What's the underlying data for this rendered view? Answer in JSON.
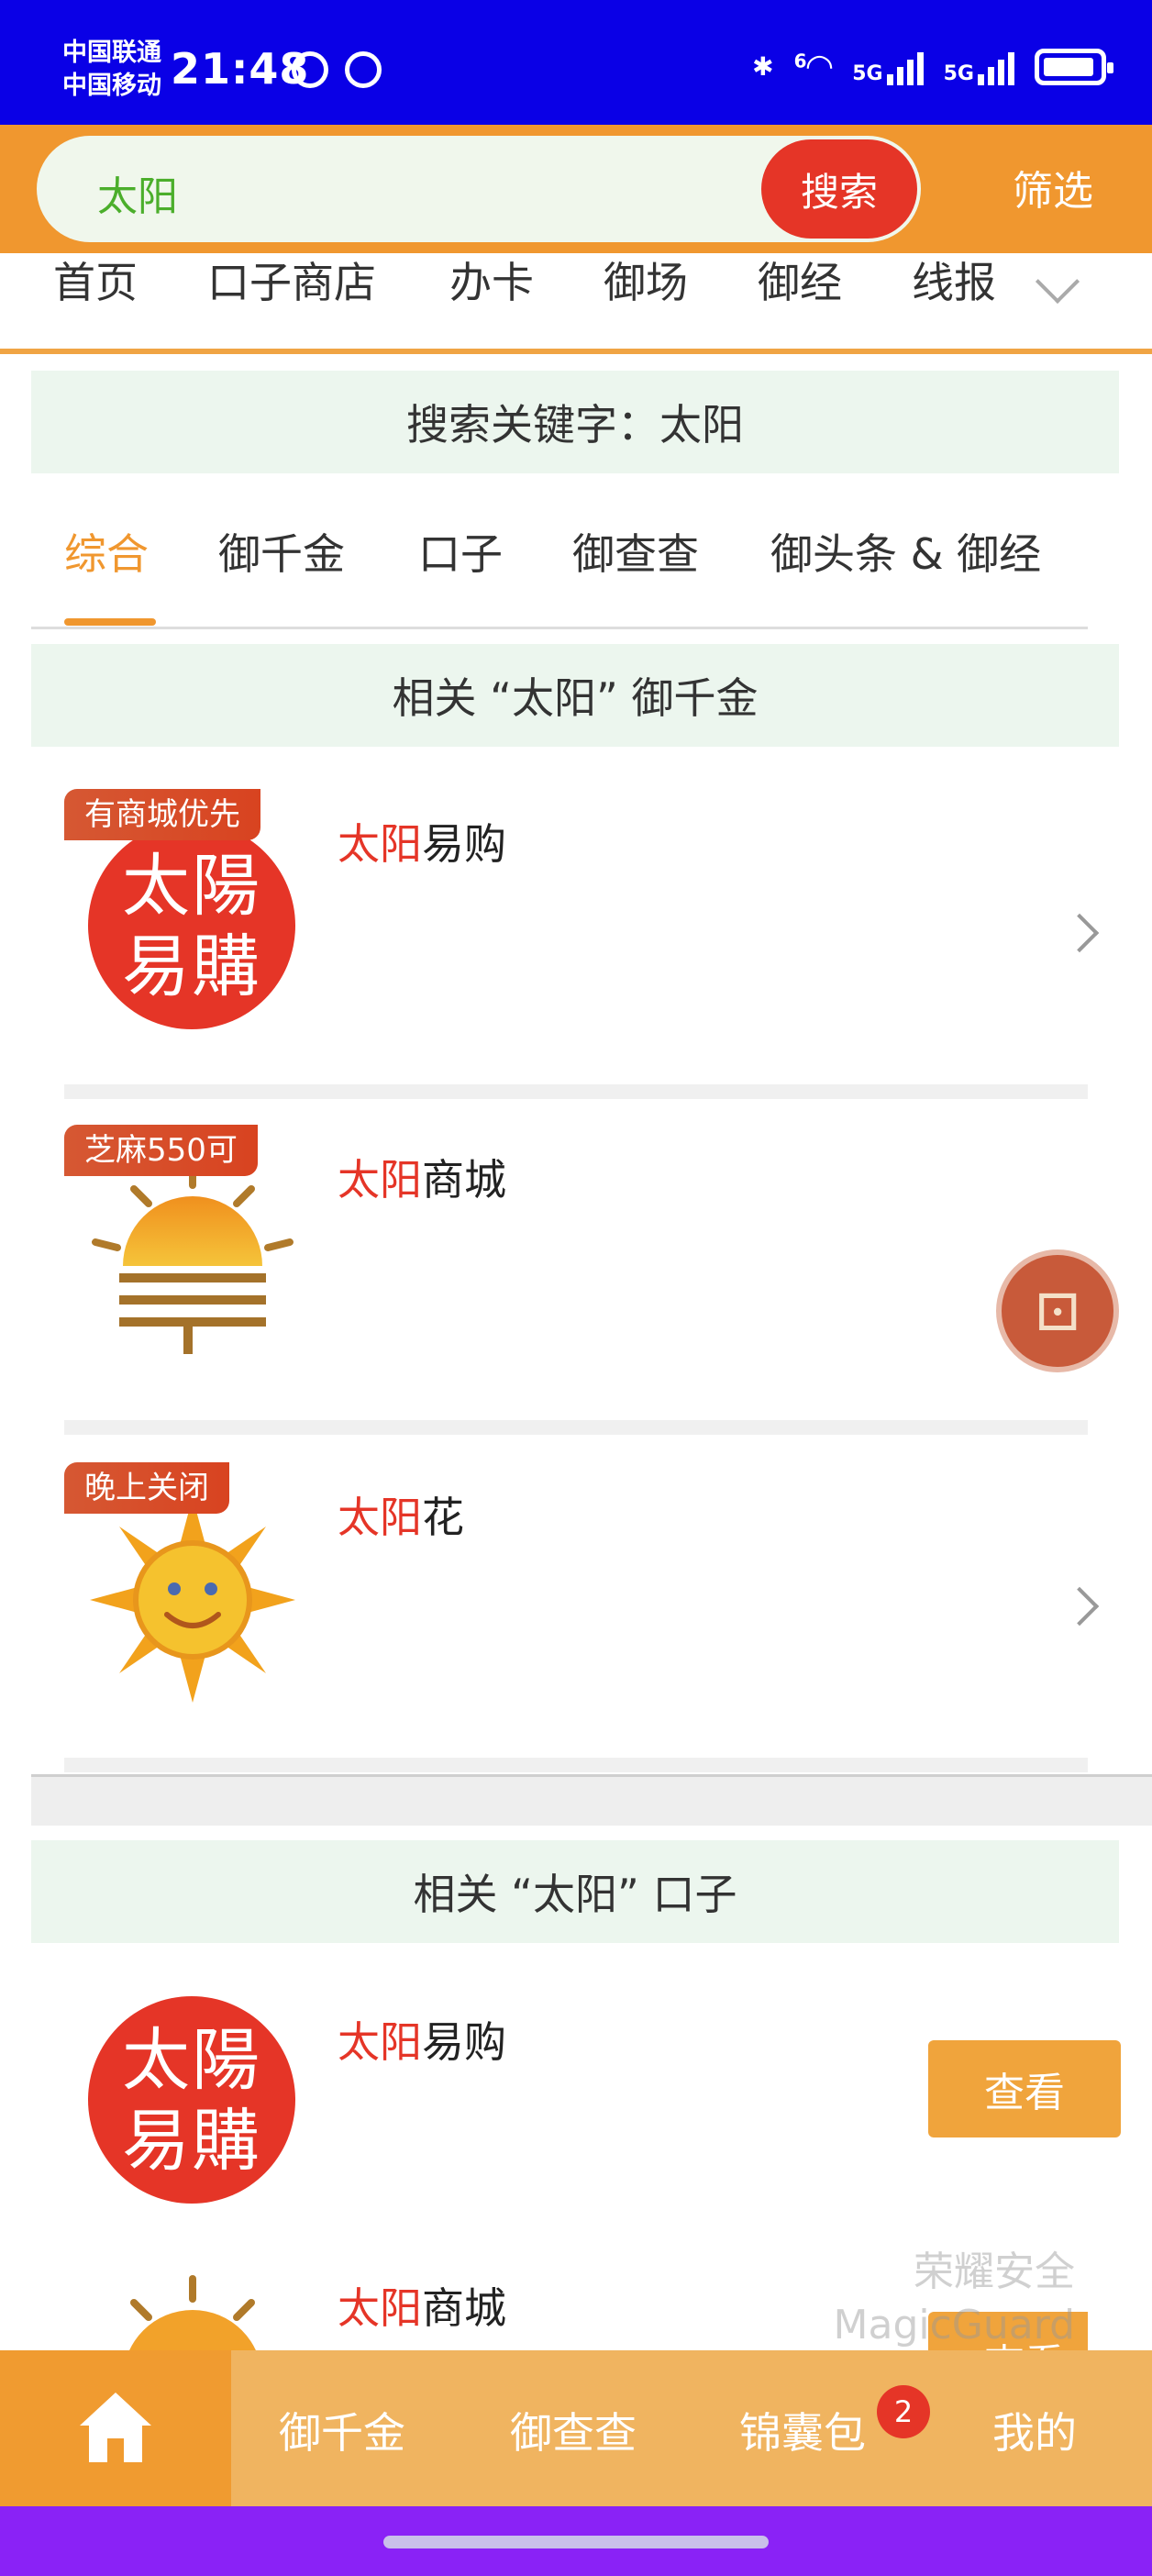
{
  "status_bar": {
    "carrier1": "中国联通",
    "carrier2": "中国移动",
    "time": "21:48",
    "net1": "5G",
    "net2": "5G",
    "wifi_label": "6"
  },
  "search": {
    "query": "太阳",
    "search_label": "搜索",
    "filter_label": "筛选"
  },
  "nav": {
    "items": [
      "首页",
      "口子商店",
      "办卡",
      "御场",
      "御经",
      "线报"
    ]
  },
  "keyword_banner": "搜索关键字：太阳",
  "filter_tabs": {
    "items": [
      "综合",
      "御千金",
      "口子",
      "御查查",
      "御头条 & 御经"
    ],
    "active": "综合"
  },
  "section1": {
    "header": "相关 “太阳” 御千金",
    "items": [
      {
        "highlight": "太阳",
        "rest": "易购",
        "tag": "有商城优先",
        "logo_text": "太陽易購"
      },
      {
        "highlight": "太阳",
        "rest": "商城",
        "tag": "芝麻550可"
      },
      {
        "highlight": "太阳",
        "rest": "花",
        "tag": "晚上关闭"
      }
    ]
  },
  "section2": {
    "header": "相关 “太阳” 口子",
    "items": [
      {
        "highlight": "太阳",
        "rest": "易购",
        "button": "查看",
        "logo_text": "太陽易購"
      },
      {
        "highlight": "太阳",
        "rest": "商城",
        "button": "查看"
      }
    ]
  },
  "watermark": {
    "line1": "荣耀安全",
    "line2": "MagicGuard"
  },
  "bottom_nav": {
    "items": [
      "御千金",
      "御查查",
      "锦囊包",
      "我的"
    ],
    "badge_count": "2"
  },
  "colors": {
    "status_bar": "#0a00e6",
    "brand_orange": "#f0972f",
    "highlight_red": "#e53527",
    "system_nav": "#8a22f6"
  }
}
